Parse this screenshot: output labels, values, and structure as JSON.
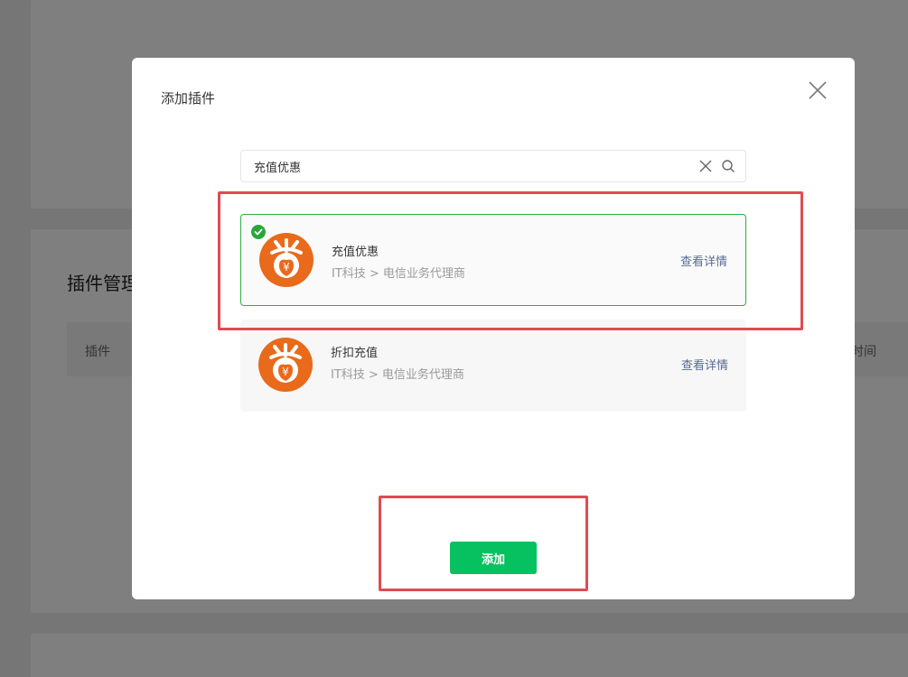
{
  "background": {
    "section_title": "插件管理",
    "table_header_plugin": "插件",
    "table_header_time": "时间"
  },
  "dialog": {
    "title": "添加插件",
    "close_icon": "close-icon",
    "search": {
      "value": "充值优惠",
      "placeholder": "",
      "clear_icon": "clear-icon",
      "search_icon": "search-icon"
    },
    "results": [
      {
        "name": "充值优惠",
        "category": "IT科技 > 电信业务代理商",
        "detail_label": "查看详情",
        "selected": true,
        "logo_icon": "sheng-discount-icon"
      },
      {
        "name": "折扣充值",
        "category": "IT科技 > 电信业务代理商",
        "detail_label": "查看详情",
        "selected": false,
        "logo_icon": "sheng-discount-icon"
      }
    ],
    "add_button_label": "添加"
  },
  "colors": {
    "accent_green": "#07c160",
    "selected_border": "#2aae3f",
    "link_blue": "#576b95",
    "logo_orange": "#e86a1a",
    "annotation_red": "#e04b52"
  }
}
